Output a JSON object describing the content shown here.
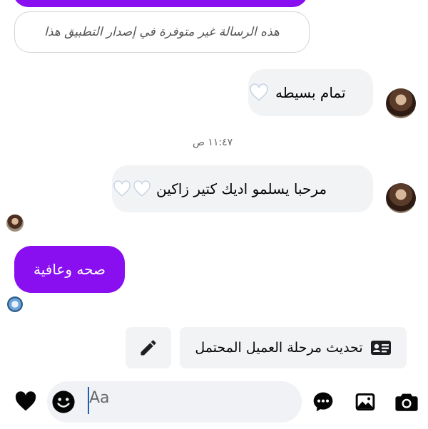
{
  "messages": {
    "unsupported_text": "هذه الرسالة غير متوفرة في إصدار التطبيق هذا",
    "msg1_text": "تمام بسيطه",
    "timestamp": "١١:٤٧ ص",
    "msg2_text": "مرحبا يسلمو اديك كتير زاكين",
    "reply_text": "صحه وعافية"
  },
  "actions": {
    "update_stage_label": "تحديث مرحلة العميل المحتمل"
  },
  "composer": {
    "placeholder": "Aa"
  },
  "icons": {
    "send_reaction": "heart-icon",
    "emoji": "emoji-icon",
    "chat": "chat-bubble-icon",
    "gallery": "image-icon",
    "camera": "camera-icon",
    "edit": "pencil-icon",
    "contact_card": "contact-card-icon"
  },
  "colors": {
    "accent": "#8a0ff0",
    "bubble_in": "#f2f3f5"
  }
}
